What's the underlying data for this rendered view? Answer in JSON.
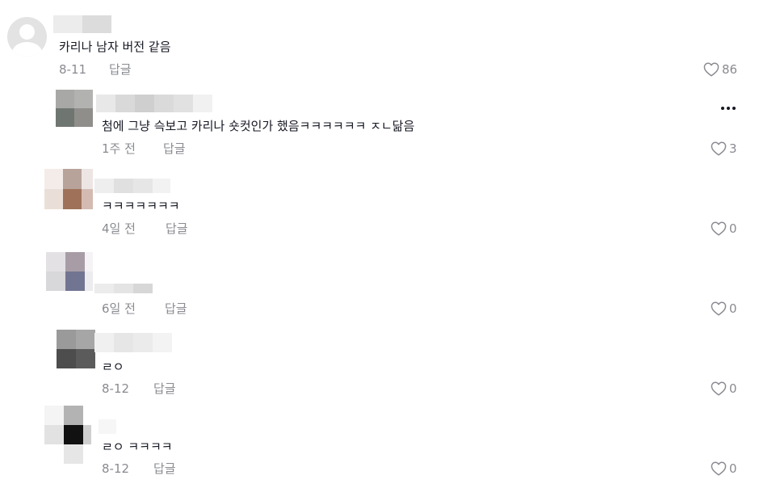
{
  "colors": {
    "text_primary": "#161823",
    "text_secondary": "#8a8b91",
    "background": "#ffffff"
  },
  "comments": [
    {
      "text": "카리나 남자 버전 같음",
      "date": "8-11",
      "reply_label": "답글",
      "likes": "86"
    },
    {
      "text": "첨에 그냥 슥보고 카리나 숏컷인가 했음ㅋㅋㅋㅋㅋㅋ ㅈㄴ닮음",
      "date": "1주 전",
      "reply_label": "답글",
      "likes": "3"
    },
    {
      "text": "ㅋㅋㅋㅋㅋㅋㅋ",
      "date": "4일 전",
      "reply_label": "답글",
      "likes": "0"
    },
    {
      "text": "",
      "date": "6일 전",
      "reply_label": "답글",
      "likes": "0"
    },
    {
      "text": "ㄹㅇ",
      "date": "8-12",
      "reply_label": "답글",
      "likes": "0"
    },
    {
      "text": "ㄹㅇ ㅋㅋㅋㅋ",
      "date": "8-12",
      "reply_label": "답글",
      "likes": "0"
    }
  ]
}
